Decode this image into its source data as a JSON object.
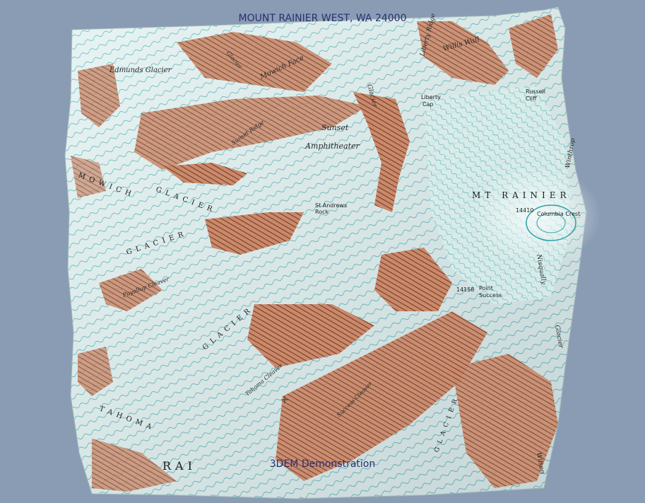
{
  "window": {
    "title": "MOUNT RAINIER WEST, WA 24000",
    "footer": "3DEM Demonstration"
  },
  "colors": {
    "background": "#8a9cb4",
    "glacier": "#dff0ef",
    "contour_ice": "#2aa0a8",
    "rock": "#a85a3c",
    "contour_rock": "#7a3a22",
    "text": "#2b2f6e"
  },
  "labels": {
    "edmunds_glacier": "Edmunds Glacier",
    "mowich_face": "Mowich Face",
    "sunset_ridge": "Sunset Ridge",
    "sunset_amphitheater_1": "Sunset",
    "sunset_amphitheater_2": "Amphitheater",
    "liberty_cap_1": "Liberty",
    "liberty_cap_2": "Cap",
    "liberty_ridge": "Liberty Ridge",
    "willis_wall": "Willis Wall",
    "russell_cliff_1": "Russell",
    "russell_cliff_2": "Cliff",
    "winthrop": "Winthrop",
    "carbon_glacier": "Glacier",
    "mowich_glacier": "MOWICH",
    "glacier_1": "GLACIER",
    "glacier_2": "GLACIER",
    "st_andrews_1": "St Andrews",
    "st_andrews_2": "Rock",
    "mt_rainier": "MT RAINIER",
    "columbia_crest": "Columbia Crest",
    "columbia_crest_elev": "14410",
    "point_success_1": "Point",
    "point_success_2": "Success",
    "point_success_elev": "14158",
    "puyallup_cleaver": "Puyallup Cleaver",
    "tahoma_glacier": "TAHOMA",
    "glacier_3": "GLACIER",
    "tahoma_cleaver": "Tahoma Cleaver",
    "success_cleaver": "Success Cleaver",
    "nisqually_glacier": "Nisqually",
    "glacier_4": "Glacier",
    "glacier_5": "GLACIER",
    "rainier_bottom": "RAI",
    "sunset_small": "Sunset",
    "mowich_glacier_top": "Glacier",
    "wilson": "Wilson"
  }
}
